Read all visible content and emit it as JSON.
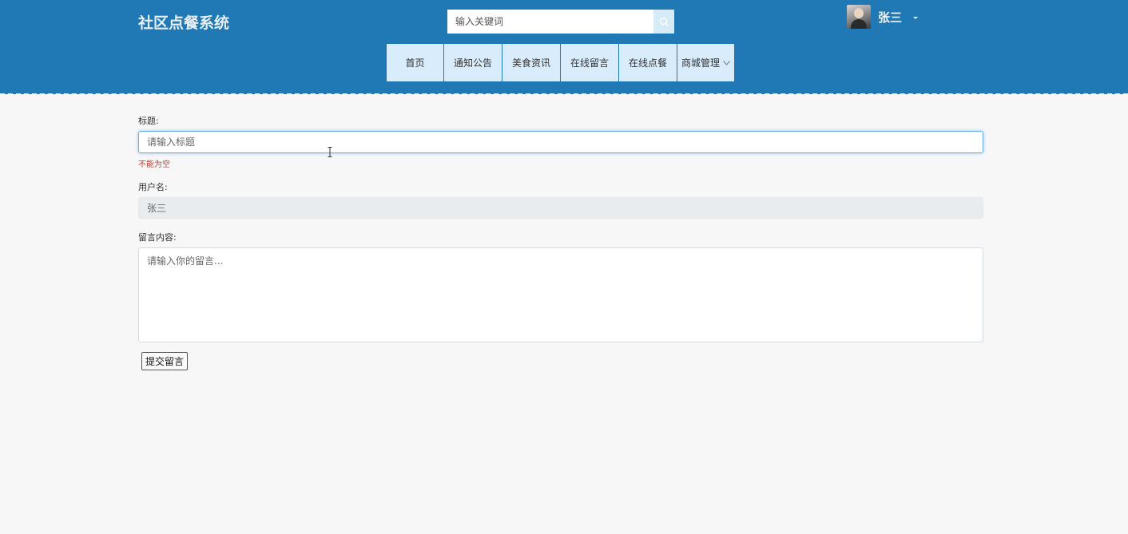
{
  "header": {
    "logo": "社区点餐系统",
    "search": {
      "placeholder": "输入关键词"
    },
    "user": {
      "name": "张三"
    }
  },
  "nav": {
    "items": [
      {
        "label": "首页"
      },
      {
        "label": "通知公告"
      },
      {
        "label": "美食资讯"
      },
      {
        "label": "在线留言"
      },
      {
        "label": "在线点餐"
      },
      {
        "label": "商城管理",
        "has_dropdown": true
      }
    ]
  },
  "form": {
    "title_label": "标题:",
    "title_placeholder": "请输入标题",
    "title_error": "不能为空",
    "username_label": "用户名:",
    "username_value": "张三",
    "content_label": "留言内容:",
    "content_placeholder": "请输入你的留言...",
    "submit_label": "提交留言"
  },
  "colors": {
    "header_bg": "#2079b5",
    "nav_item_bg": "#d9ecfb",
    "error_text": "#c0392b",
    "page_bg": "#f7f7f7"
  }
}
